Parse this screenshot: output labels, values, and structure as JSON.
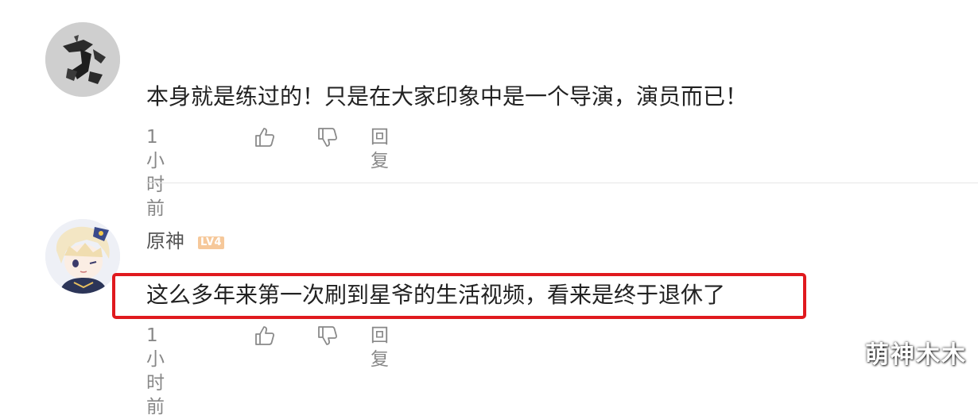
{
  "comments": [
    {
      "username": "",
      "text": "本身就是练过的！只是在大家印象中是一个导演，演员而已！",
      "time": "1小时前",
      "reply_label": "回复",
      "avatar_icon": "ink-calligraphy-avatar"
    },
    {
      "username": "原神",
      "level_badge": "LV4",
      "text": "这么多年来第一次刷到星爷的生活视频，看来是终于退休了",
      "time": "1小时前",
      "reply_label": "回复",
      "avatar_icon": "anime-character-avatar",
      "highlighted": true
    }
  ],
  "actions": {
    "like_icon": "thumbs-up-icon",
    "dislike_icon": "thumbs-down-icon"
  },
  "watermark": "萌神木木",
  "colors": {
    "highlight_border": "#e0191e",
    "badge": "#f6c89a",
    "meta_text": "#888888"
  }
}
